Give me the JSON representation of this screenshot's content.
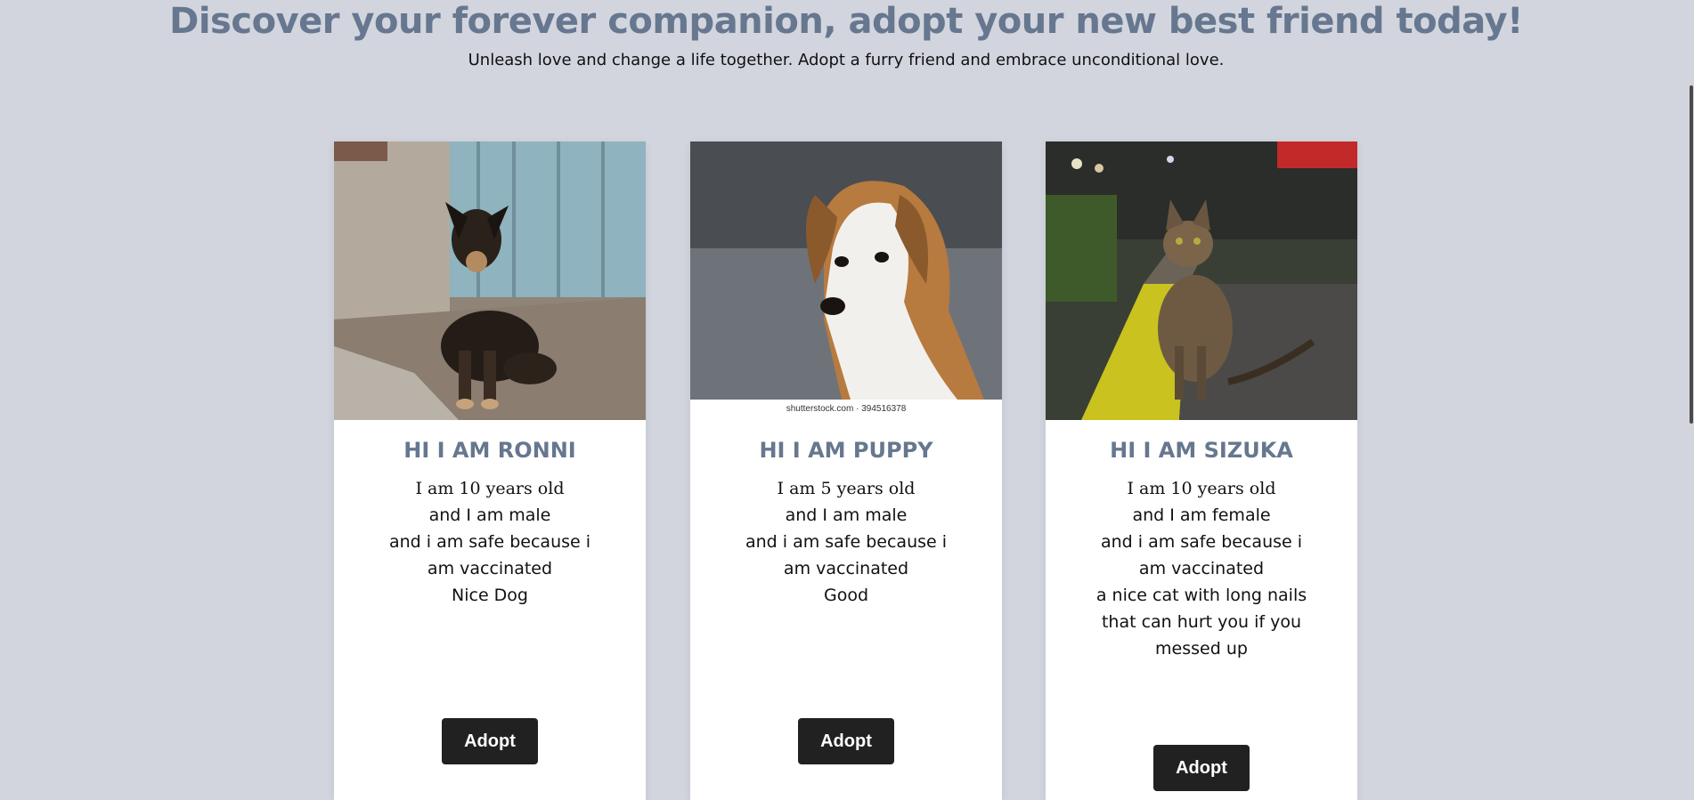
{
  "header": {
    "title": "Discover your forever companion, adopt your new best friend today!",
    "subtitle": "Unleash love and change a life together. Adopt a furry friend and embrace unconditional love."
  },
  "pets": [
    {
      "name": "HI I AM RONNI",
      "age": "I am 10 years old",
      "gender": "and I am male",
      "safety": "and i am safe because i am vaccinated",
      "description": "Nice Dog",
      "button": "Adopt",
      "photo_icon": "dog-photo"
    },
    {
      "name": "HI I AM PUPPY",
      "age": "I am 5 years old",
      "gender": "and I am male",
      "safety": "and i am safe because i am vaccinated",
      "description": "Good",
      "button": "Adopt",
      "photo_icon": "puppy-photo",
      "watermark": "shutterstock.com · 394516378"
    },
    {
      "name": "HI I AM SIZUKA",
      "age": "I am 10 years old",
      "gender": "and I am female",
      "safety": "and i am safe because i am vaccinated",
      "description": "a nice cat with long nails that can hurt you if you messed up",
      "button": "Adopt",
      "photo_icon": "cat-photo"
    }
  ],
  "colors": {
    "background": "#d2d5de",
    "heading": "#66778f",
    "button": "#212121"
  }
}
